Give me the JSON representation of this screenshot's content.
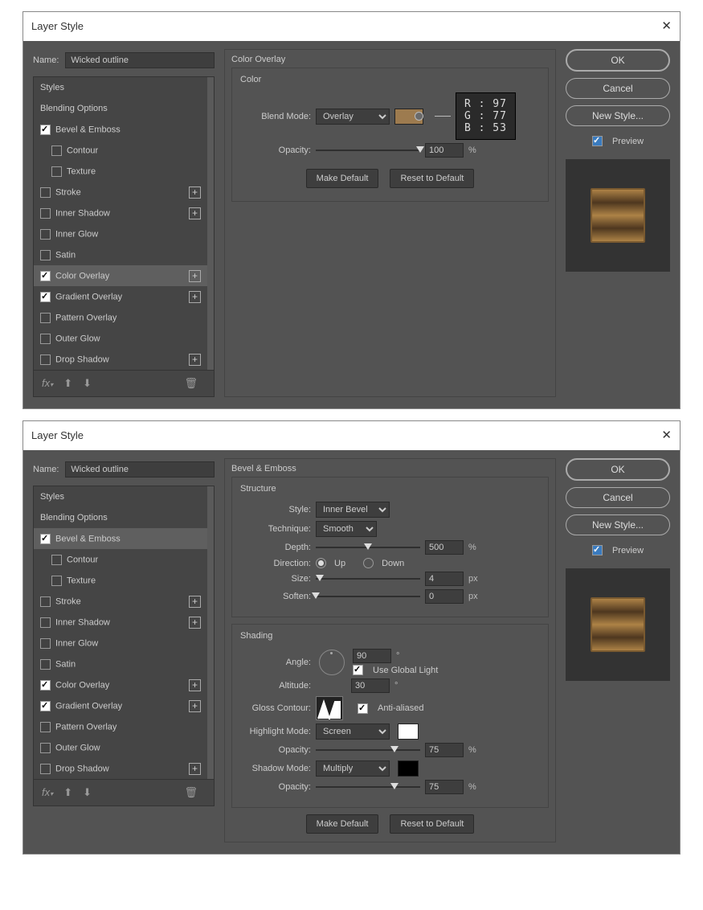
{
  "dialogs": [
    {
      "name": "Wicked outline",
      "panel": "color"
    },
    {
      "name": "Wicked outline",
      "panel": "bevel"
    }
  ],
  "title": "Layer Style",
  "name_label": "Name:",
  "sidebar": {
    "header": "Styles",
    "blending": "Blending Options",
    "items": [
      {
        "label": "Bevel & Emboss",
        "on": true,
        "plus": false
      },
      {
        "label": "Contour",
        "on": false,
        "sub": true
      },
      {
        "label": "Texture",
        "on": false,
        "sub": true
      },
      {
        "label": "Stroke",
        "on": false,
        "plus": true
      },
      {
        "label": "Inner Shadow",
        "on": false,
        "plus": true
      },
      {
        "label": "Inner Glow",
        "on": false
      },
      {
        "label": "Satin",
        "on": false
      },
      {
        "label": "Color Overlay",
        "on": true,
        "plus": true
      },
      {
        "label": "Gradient Overlay",
        "on": true,
        "plus": true
      },
      {
        "label": "Pattern Overlay",
        "on": false
      },
      {
        "label": "Outer Glow",
        "on": false
      },
      {
        "label": "Drop Shadow",
        "on": false,
        "plus": true
      }
    ],
    "fx": "fx"
  },
  "buttons": {
    "ok": "OK",
    "cancel": "Cancel",
    "newstyle": "New Style...",
    "preview": "Preview",
    "mkdef": "Make Default",
    "reset": "Reset to Default"
  },
  "color_overlay": {
    "title": "Color Overlay",
    "sub": "Color",
    "blendmode_label": "Blend Mode:",
    "blendmode": "Overlay",
    "opacity_label": "Opacity:",
    "opacity": "100",
    "opacity_unit": "%",
    "rgb": {
      "r": "R : 97",
      "g": "G : 77",
      "b": "B : 53"
    },
    "chip": "#9d7b4f"
  },
  "bevel": {
    "title": "Bevel & Emboss",
    "structure": "Structure",
    "style_label": "Style:",
    "style": "Inner Bevel",
    "technique_label": "Technique:",
    "technique": "Smooth",
    "depth_label": "Depth:",
    "depth": "500",
    "depth_unit": "%",
    "direction_label": "Direction:",
    "up": "Up",
    "down": "Down",
    "size_label": "Size:",
    "size": "4",
    "size_unit": "px",
    "soften_label": "Soften:",
    "soften": "0",
    "soften_unit": "px",
    "shading": "Shading",
    "angle_label": "Angle:",
    "angle": "90",
    "deg": "°",
    "global": "Use Global Light",
    "altitude_label": "Altitude:",
    "altitude": "30",
    "gloss_label": "Gloss Contour:",
    "aa": "Anti-aliased",
    "hl_label": "Highlight Mode:",
    "hl": "Screen",
    "hl_op": "75",
    "sh_label": "Shadow Mode:",
    "sh": "Multiply",
    "sh_op": "75",
    "op_label": "Opacity:",
    "op_unit": "%"
  }
}
